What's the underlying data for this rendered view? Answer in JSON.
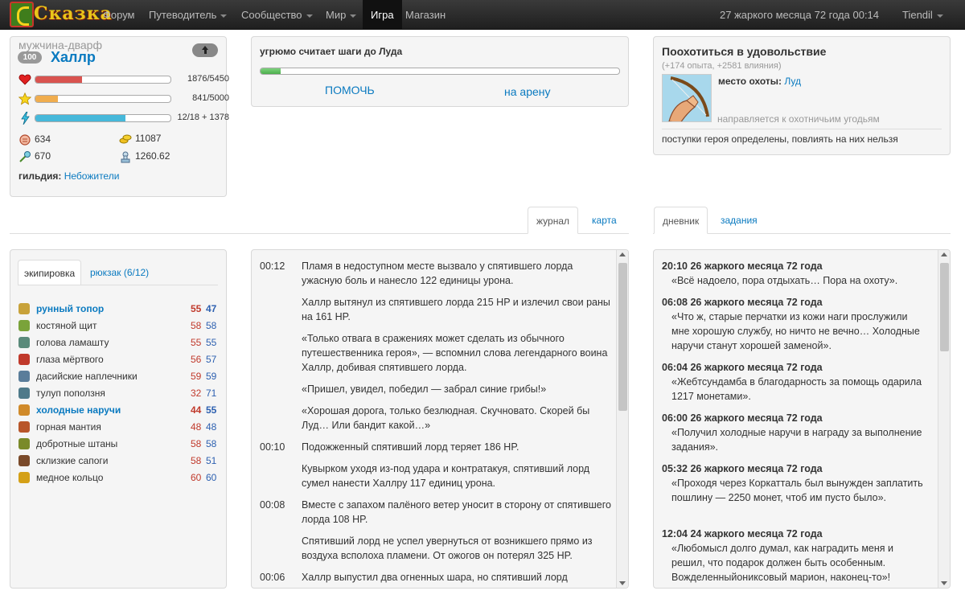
{
  "nav": {
    "logo": "Сказка",
    "items": [
      {
        "label": "Форум",
        "dropdown": false
      },
      {
        "label": "Путеводитель",
        "dropdown": true
      },
      {
        "label": "Сообщество",
        "dropdown": true
      },
      {
        "label": "Мир",
        "dropdown": true
      },
      {
        "label": "Игра",
        "dropdown": false,
        "active": true
      },
      {
        "label": "Магазин",
        "dropdown": false
      }
    ],
    "game_date": "27 жаркого месяца 72 года 00:14",
    "user": "Tiendil"
  },
  "hero": {
    "race": "мужчина-дварф",
    "level": "100",
    "name": "Халлр",
    "health": {
      "text": "1876/5450",
      "fraction": 0.344,
      "color": "#d9534f"
    },
    "experience": {
      "text": "841/5000",
      "fraction": 0.168,
      "color": "#f0ad4e"
    },
    "energy": {
      "text": "12/18 + 1378",
      "fraction": 0.667,
      "color": "#46b8da"
    },
    "power_physical": "634",
    "power_magic": "670",
    "money": "11087",
    "might": "1260.62",
    "guild_label": "гильдия:",
    "guild": "Небожители"
  },
  "action": {
    "title": "угрюмо считает шаги до Луда",
    "progress": 0.055,
    "help_button": "ПОМОЧЬ",
    "arena_link": "на арену"
  },
  "quest": {
    "title": "Поохотиться в удовольствие",
    "reward": "(+174 опыта, +2581 влияния)",
    "place_label": "место охоты:",
    "place": "Луд",
    "status": "направляется к охотничьим угодьям",
    "note": "поступки героя определены, повлиять на них нельзя"
  },
  "journal_tabs": {
    "journal": "журнал",
    "map": "карта"
  },
  "diary_tabs": {
    "diary": "дневник",
    "quests": "задания"
  },
  "equipment": {
    "tab_equipment": "экипировка",
    "tab_bag": "рюкзак (6/12)",
    "items": [
      {
        "name": "рунный топор",
        "p": "55",
        "m": "47",
        "highlight": true,
        "icon": "axe-icon",
        "color": "#c8a23a"
      },
      {
        "name": "костяной щит",
        "p": "58",
        "m": "58",
        "highlight": false,
        "icon": "shield-icon",
        "color": "#7aa33a"
      },
      {
        "name": "голова ламашту",
        "p": "55",
        "m": "55",
        "highlight": false,
        "icon": "helmet-icon",
        "color": "#5a8a7a"
      },
      {
        "name": "глаза мёртвого",
        "p": "56",
        "m": "57",
        "highlight": false,
        "icon": "amulet-icon",
        "color": "#c0392b"
      },
      {
        "name": "дасийские наплечники",
        "p": "59",
        "m": "59",
        "highlight": false,
        "icon": "shoulders-icon",
        "color": "#5a7d9a"
      },
      {
        "name": "тулуп поползня",
        "p": "32",
        "m": "71",
        "highlight": false,
        "icon": "armor-icon",
        "color": "#4f7a8a"
      },
      {
        "name": "холодные наручи",
        "p": "44",
        "m": "55",
        "highlight": true,
        "icon": "bracers-icon",
        "color": "#d08a2a"
      },
      {
        "name": "горная мантия",
        "p": "48",
        "m": "48",
        "highlight": false,
        "icon": "cloak-icon",
        "color": "#b8562a"
      },
      {
        "name": "добротные штаны",
        "p": "58",
        "m": "58",
        "highlight": false,
        "icon": "pants-icon",
        "color": "#7a8a2a"
      },
      {
        "name": "склизкие сапоги",
        "p": "58",
        "m": "51",
        "highlight": false,
        "icon": "boots-icon",
        "color": "#7a4a2a"
      },
      {
        "name": "медное кольцо",
        "p": "60",
        "m": "60",
        "highlight": false,
        "icon": "ring-icon",
        "color": "#d4a017"
      }
    ]
  },
  "journal": [
    {
      "time": "00:12",
      "text": "Пламя в недоступном месте вызвало у спятившего лорда ужасную боль и нанесло 122 единицы урона."
    },
    {
      "time": "",
      "text": "Халлр вытянул из спятившего лорда 215 HP и излечил свои раны на 161 HP."
    },
    {
      "time": "",
      "text": "«Только отвага в сражениях может сделать из обычного путешественника героя», — вспомнил слова легендарного воина Халлр, добивая спятившего лорда."
    },
    {
      "time": "",
      "text": "«Пришел, увидел, победил — забрал синие грибы!»"
    },
    {
      "time": "",
      "text": "«Хорошая дорога, только безлюдная. Скучновато. Скорей бы Луд… Или бандит какой…»"
    },
    {
      "time": "00:10",
      "text": "Подожженный спятивший лорд теряет 186 HP."
    },
    {
      "time": "",
      "text": "Кувырком уходя из-под удара и контратакуя, спятивший лорд сумел нанести Халлру 117 единиц урона."
    },
    {
      "time": "00:08",
      "text": "Вместе с запахом палёного ветер уносит в сторону от спятившего лорда 108 HP."
    },
    {
      "time": "",
      "text": "Спятивший лорд не успел увернуться от возникшего прямо из воздуха всполоха пламени. От ожогов он потерял 325 HP."
    },
    {
      "time": "00:06",
      "text": "Халлр выпустил два огненных шара, но спятивший лорд"
    }
  ],
  "diary": [
    {
      "time": "20:10 26 жаркого месяца 72 года",
      "text": "«Всё надоело, пора отдыхать… Пора на охоту»."
    },
    {
      "time": "06:08 26 жаркого месяца 72 года",
      "text": "«Что ж, старые перчатки из кожи наги прослужили мне хорошую службу, но ничто не вечно… Холодные наручи станут хорошей заменой»."
    },
    {
      "time": "06:04 26 жаркого месяца 72 года",
      "text": "«Жебтсундамба в благодарность за помощь одарила 1217 монетами»."
    },
    {
      "time": "06:00 26 жаркого месяца 72 года",
      "text": "«Получил холодные наручи в награду за выполнение задания»."
    },
    {
      "time": "05:32 26 жаркого месяца 72 года",
      "text": "«Проходя через Коркатталь был вынужден заплатить пошлину — 2250 монет, чтоб им пусто было»."
    },
    {
      "time": "12:04 24 жаркого месяца 72 года",
      "text": "«Любомысл долго думал, как наградить меня и решил, что подарок должен быть особенным. Вожделенныйониксовый марион, наконец-то»!"
    }
  ]
}
